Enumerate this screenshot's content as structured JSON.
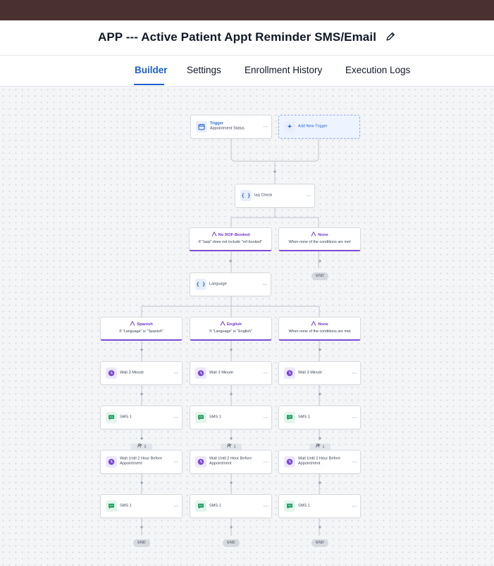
{
  "header": {
    "title": "APP --- Active Patient Appt Reminder SMS/Email",
    "edit_icon": "pencil-icon"
  },
  "tabs": [
    {
      "label": "Builder",
      "active": true
    },
    {
      "label": "Settings",
      "active": false
    },
    {
      "label": "Enrollment History",
      "active": false
    },
    {
      "label": "Execution Logs",
      "active": false
    }
  ],
  "colors": {
    "topbar": "#4a3030",
    "accent_blue": "#1d5ecf",
    "branch_purple": "#7b4bd6",
    "sms_green": "#1f9d60"
  },
  "workflow": {
    "trigger": {
      "label": "Trigger",
      "detail": "Appointment Status",
      "icon": "calendar-icon"
    },
    "add_trigger": {
      "label": "Add New Trigger",
      "icon": "plus-icon"
    },
    "iaq_check": {
      "label": "Iaq Check",
      "icon": "code-braces-icon"
    },
    "branches1": [
      {
        "title": "No ROF-Booked",
        "detail": "If \"Iaqs\" does not include \"rof-booked\""
      },
      {
        "title": "None",
        "detail": "When none of the conditions are met"
      }
    ],
    "language": {
      "label": "Language",
      "icon": "code-braces-icon"
    },
    "end_label": "END",
    "branches2": [
      {
        "title": "Spanish",
        "detail": "If \"Language\" is \"Spanish\"",
        "wait": "Wait 3 Minute",
        "sms1": "SMS 1",
        "count": "2",
        "wait2": "Wait Until 2 Hour Before Appointment",
        "sms2": "SMS 1"
      },
      {
        "title": "English",
        "detail": "If \"Language\" is \"English\"",
        "wait": "Wait 3 Minute",
        "sms1": "SMS 1",
        "count": "1",
        "wait2": "Wait Until 2 Hour Before Appointment",
        "sms2": "SMS 1"
      },
      {
        "title": "None",
        "detail": "When none of the conditions are met",
        "wait": "Wait 3 Minute",
        "sms1": "SMS 1",
        "count": "1",
        "wait2": "Wait Until 2 Hour Before Appointment",
        "sms2": "SMS 1"
      }
    ]
  }
}
